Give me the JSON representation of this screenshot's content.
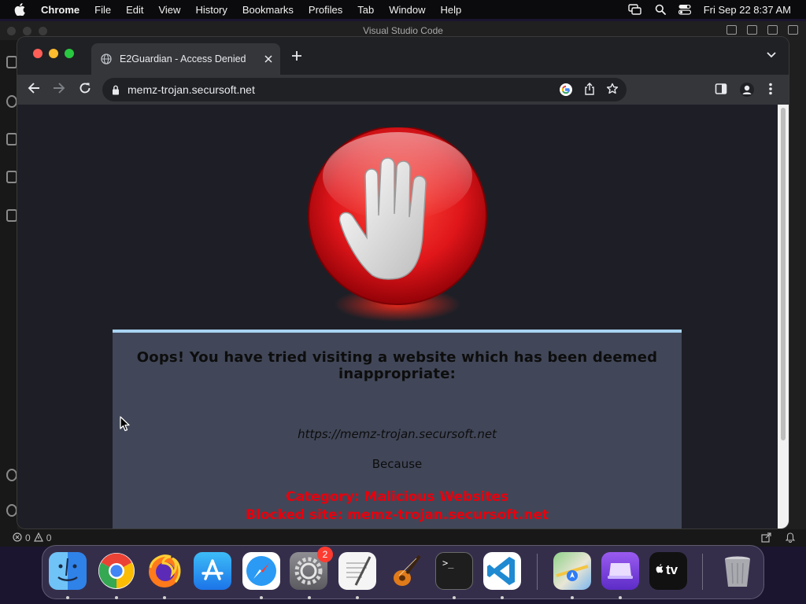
{
  "menubar": {
    "app_name": "Chrome",
    "items": [
      "File",
      "Edit",
      "View",
      "History",
      "Bookmarks",
      "Profiles",
      "Tab",
      "Window",
      "Help"
    ],
    "clock": "Fri Sep 22  8:37 AM"
  },
  "vscode": {
    "title": "Visual Studio Code",
    "status": {
      "errors": "0",
      "warnings": "0"
    }
  },
  "browser": {
    "tab_title": "E2Guardian - Access Denied",
    "url": "memz-trojan.secursoft.net"
  },
  "page": {
    "headline": "Oops! You have tried visiting a website which has been deemed inappropriate:",
    "blocked_url": "https://memz-trojan.secursoft.net",
    "because": "Because",
    "category": "Category: Malicious Websites",
    "blocked_site": "Blocked site: memz-trojan.secursoft.net"
  },
  "dock": {
    "apps": [
      "Finder",
      "Google Chrome",
      "Firefox",
      "App Store",
      "Safari",
      "System Settings",
      "TextEdit",
      "GarageBand",
      "Terminal",
      "Visual Studio Code",
      "Maps",
      "Apple Configurator",
      "Apple TV",
      "Trash"
    ],
    "settings_badge": "2",
    "terminal_prompt": ">_",
    "tv_label": "tv"
  },
  "colors": {
    "close": "#ff5f57",
    "minimize": "#febc2e",
    "zoom": "#28c840",
    "panel": "#414758",
    "panel_accent": "#a9d3f2",
    "reason": "#e8000d"
  }
}
